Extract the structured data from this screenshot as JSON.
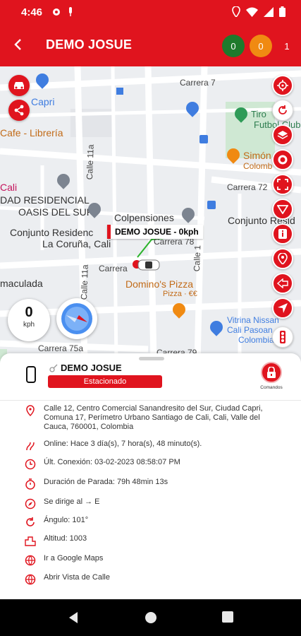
{
  "status_bar": {
    "time": "4:46",
    "left_icons": [
      "gear-icon",
      "microphone-icon"
    ],
    "right_icons": [
      "location-pin-icon",
      "wifi-icon",
      "signal-icon",
      "battery-icon"
    ]
  },
  "app_bar": {
    "title": "DEMO JOSUE",
    "counters": [
      {
        "value": "0",
        "color": "#1e7a2c"
      },
      {
        "value": "0",
        "color": "#f08a12"
      },
      {
        "value": "1",
        "color": "#e0141e"
      }
    ]
  },
  "map": {
    "labels": {
      "capri": "Capri",
      "cafe": "Cafe - Librería",
      "cali": "Cali",
      "residencial1": "DAD RESIDENCIAL",
      "residencial2": "OASIS DEL SUR",
      "conjunto": "Conjunto Residenc",
      "coruna": "La Coruña, Cali",
      "colpensiones": "Colpensiones",
      "maculada": "maculada",
      "carrera_left": "Carrera",
      "carrera75a": "Carrera 75a",
      "carrera78": "Carrera 78",
      "carrera72": "Carrera 72",
      "calle11a": "Calle 11a",
      "calle11a_b": "Calle 11a",
      "calle1": "Calle 1",
      "dominos": "Domino's Pizza",
      "pizza": "Pizza · €€",
      "tiro1": "Tiro",
      "tiro2": "Futbol Club",
      "simon": "Simón",
      "colombia": "Colomb",
      "conjunto_right": "Conjunto Resid",
      "vitrina1": "Vitrina Nissan",
      "vitrina2": "Cali Pasoan",
      "vitrina3": "Colombia",
      "carrera79": "Carrera 79",
      "carrera7x": "Carrera 7"
    },
    "vehicle_callout": "DEMO JOSUE - 0kph",
    "speed": {
      "value": "0",
      "unit": "kph"
    },
    "left_buttons": [
      "car-icon",
      "share-icon"
    ],
    "right_buttons": [
      "target-icon",
      "refresh-icon",
      "layers-icon",
      "speed-limit-icon",
      "fullscreen-icon",
      "triangle-icon",
      "info-icon",
      "pin-icon",
      "arrow-left-icon",
      "navigation-icon",
      "traffic-light-icon"
    ]
  },
  "sheet": {
    "device_name": "DEMO JOSUE",
    "status": "Estacionado",
    "commands_label": "Comandos",
    "rows": [
      {
        "icon": "location-icon",
        "text": "Calle 12, Centro Comercial Sanandresito del Sur, Ciudad Capri, Comuna 17, Perímetro Urbano Santiago de Cali, Cali, Valle del Cauca, 760001, Colombia"
      },
      {
        "icon": "online-icon",
        "text": "Online: Hace 3 día(s), 7 hora(s), 48 minuto(s)."
      },
      {
        "icon": "clock-icon",
        "text": "Últ. Conexión: 03-02-2023 08:58:07 PM"
      },
      {
        "icon": "stopwatch-icon",
        "text": "Duración de Parada: 79h 48min 13s"
      },
      {
        "icon": "compass-icon",
        "text": "Se dirige al → E"
      },
      {
        "icon": "angle-icon",
        "text": "Ángulo: 101°"
      },
      {
        "icon": "altitude-icon",
        "text": "Altitud: 1003"
      },
      {
        "icon": "globe-icon",
        "text": "Ir a Google Maps"
      },
      {
        "icon": "globe-icon",
        "text": "Abrir Vista de Calle"
      }
    ]
  },
  "colors": {
    "accent": "#e0141e",
    "map_bg": "#eceef1"
  }
}
